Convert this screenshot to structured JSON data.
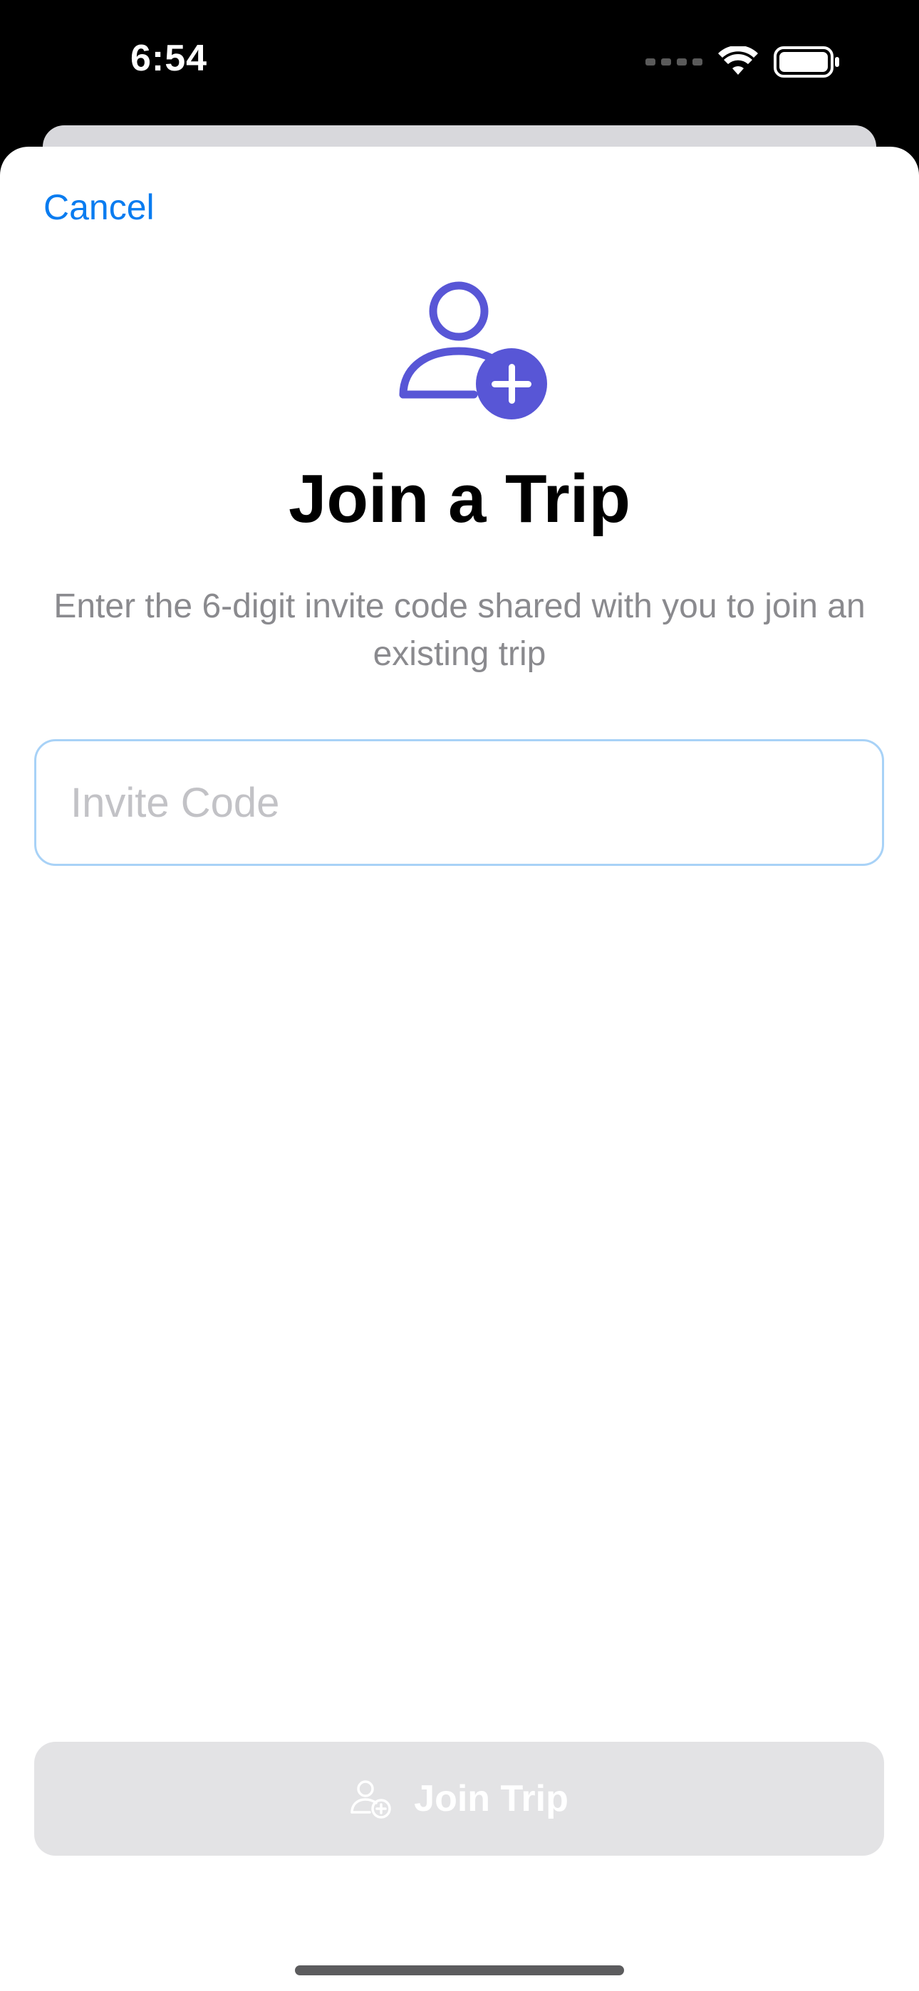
{
  "status_bar": {
    "time": "6:54",
    "icons": [
      "cellular-signal-icon",
      "wifi-icon",
      "battery-icon"
    ]
  },
  "sheet": {
    "cancel_label": "Cancel",
    "hero_icon": "person-add-icon",
    "title": "Join a Trip",
    "subtitle": "Enter the 6-digit invite code shared with you to join an existing trip",
    "invite_field": {
      "placeholder": "Invite Code",
      "value": ""
    },
    "join_button": {
      "label": "Join Trip",
      "icon": "person-add-icon",
      "enabled": false
    }
  },
  "colors": {
    "accent": "#0a7cf0",
    "icon_purple": "#5856d6",
    "disabled_button": "#e3e3e5",
    "subtitle_gray": "#8a8a8e"
  }
}
